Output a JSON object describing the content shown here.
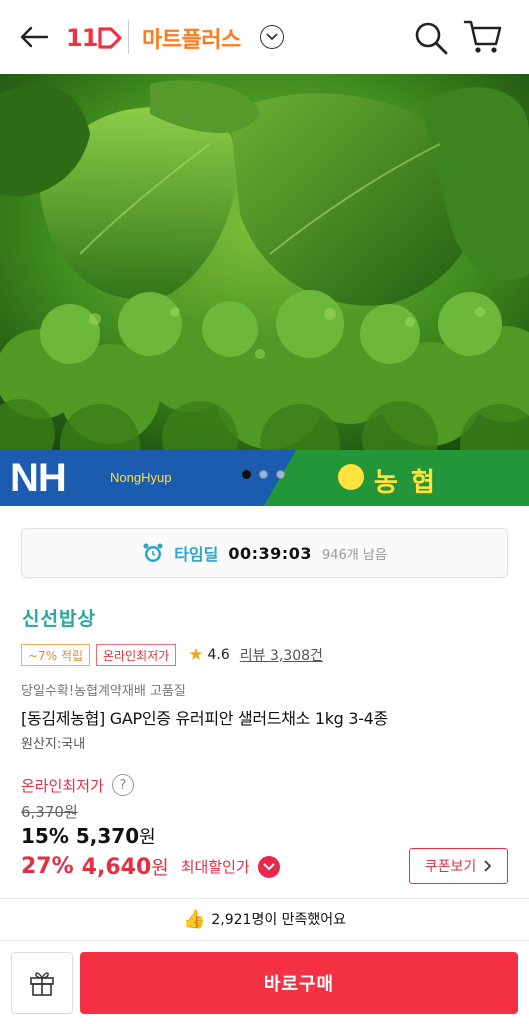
{
  "header": {
    "logo_text": "11",
    "brand": "마트플러스"
  },
  "banner": {
    "nh_logo": "NH",
    "nh_sub": "NongHyup",
    "nh_korean": "농 협",
    "carousel_total": 3,
    "carousel_active": 1
  },
  "timedeal": {
    "label": "타임딜",
    "time": "00:39:03",
    "stock": "946개 남음"
  },
  "product": {
    "store": "신선밥상",
    "tag_points": "~7% 적립",
    "tag_lowest": "온라인최저가",
    "rating": "4.6",
    "review_label": "리뷰 3,308건",
    "subtitle": "당일수확!농협계약재배 고품질",
    "title": "[동김제농협] GAP인증 유러피안 샐러드채소 1kg 3-4종",
    "origin": "원산지:국내"
  },
  "price": {
    "lowest_label": "온라인최저가",
    "original": "6,370원",
    "discount_pct": "15%",
    "discount_price": "5,370",
    "max_pct": "27%",
    "max_price": "4,640",
    "won": "원",
    "max_label": "최대할인가",
    "coupon_label": "쿠폰보기"
  },
  "satisfaction": {
    "text": "2,921명이 만족했어요"
  },
  "bottom": {
    "buy_label": "바로구매"
  },
  "colors": {
    "brand_red": "#f43142",
    "brand_orange": "#ff7a1a",
    "store_teal": "#2aa6a0",
    "price_red": "#e43044"
  }
}
